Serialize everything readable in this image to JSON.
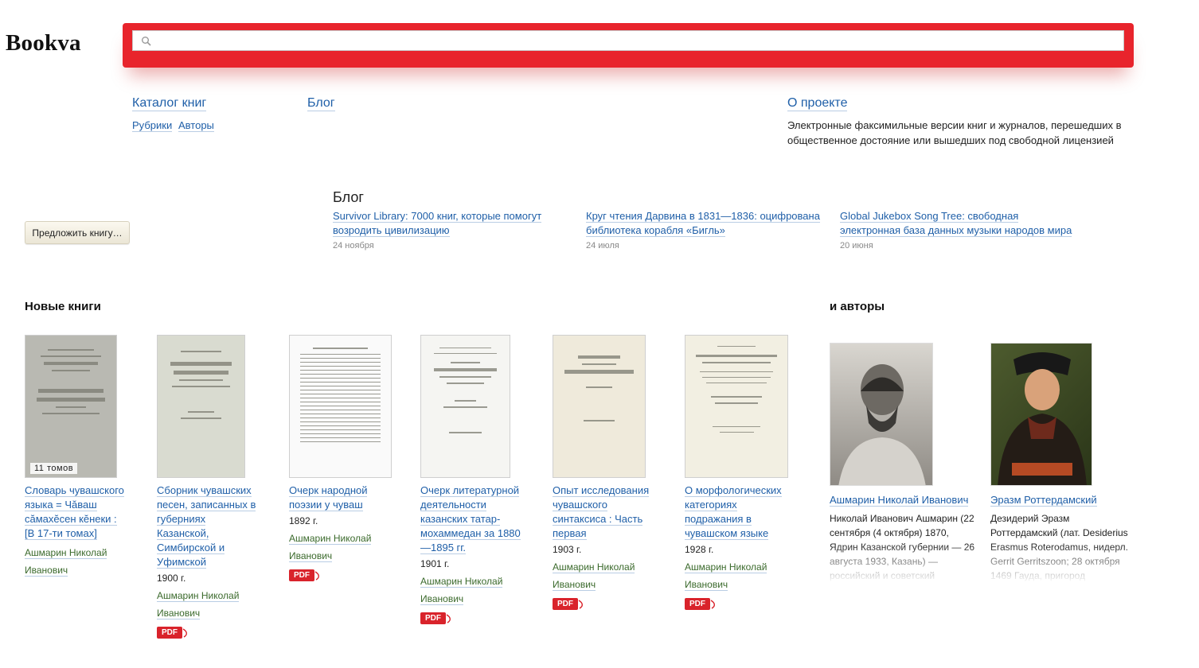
{
  "header": {
    "logo": "Bookva",
    "search": {
      "value": "",
      "placeholder": ""
    },
    "accent_color": "#e8242c"
  },
  "nav": {
    "catalog": "Каталог книг",
    "rubrics": "Рубрики",
    "authors": "Авторы",
    "blog": "Блог",
    "about": "О проекте",
    "about_text": "Электронные факсимильные версии книг и журналов, перешедших в общественное достояние или вышедших под свободной лицензией"
  },
  "suggest_button": "Предложить книгу…",
  "blog": {
    "heading": "Блог",
    "posts": [
      {
        "title": "Survivor Library: 7000 книг, которые помогут возродить цивилизацию",
        "date": "24 ноября"
      },
      {
        "title": "Круг чтения Дарвина в 1831—1836: оцифрована библиотека корабля «Бигль»",
        "date": "24 июля"
      },
      {
        "title": "Global Jukebox Song Tree: свободная электронная база данных музыки народов мира",
        "date": "20 июня"
      }
    ]
  },
  "new_books": {
    "heading": "Новые книги",
    "books": [
      {
        "title": "Словарь чувашского языка = Чăваш сăмахĕсен кĕнеки : [В 17-ти томах]",
        "year": "",
        "author": "Ашмарин Николай Иванович",
        "badge": "11 томов",
        "pdf": ""
      },
      {
        "title": "Сборник чувашских песен, записанных в губерниях Казанской, Симбирской и Уфимской",
        "year": "1900 г.",
        "author": "Ашмарин Николай Иванович",
        "badge": "",
        "pdf": "PDF"
      },
      {
        "title": "Очерк народной поэзии у чуваш",
        "year": "1892 г.",
        "author": "Ашмарин Николай Иванович",
        "badge": "",
        "pdf": "PDF"
      },
      {
        "title": "Очерк литературной деятельности казанских татар-мохаммедан за 1880—1895 гг.",
        "year": "1901 г.",
        "author": "Ашмарин Николай Иванович",
        "badge": "",
        "pdf": "PDF"
      },
      {
        "title": "Опыт исследования чувашского синтаксиса : Часть первая",
        "year": "1903 г.",
        "author": "Ашмарин Николай Иванович",
        "badge": "",
        "pdf": "PDF"
      },
      {
        "title": "О морфологических категориях подражания в чувашском языке",
        "year": "1928 г.",
        "author": "Ашмарин Николай Иванович",
        "badge": "",
        "pdf": "PDF"
      }
    ]
  },
  "authors_section": {
    "heading": "и авторы",
    "authors": [
      {
        "name": "Ашмарин Николай Иванович",
        "bio": "Николай Иванович Ашмарин (22 сентября (4 октября) 1870, Ядрин Казанской губернии — 26 августа 1933, Казань) — российский и советский"
      },
      {
        "name": "Эразм Роттердамский",
        "bio": "Дезидерий Эразм Роттердамский (лат. Desiderius Erasmus Roterodamus, нидерл. Gerrit Gerritszoon; 28 октября 1469 Гауда, пригород"
      }
    ]
  }
}
